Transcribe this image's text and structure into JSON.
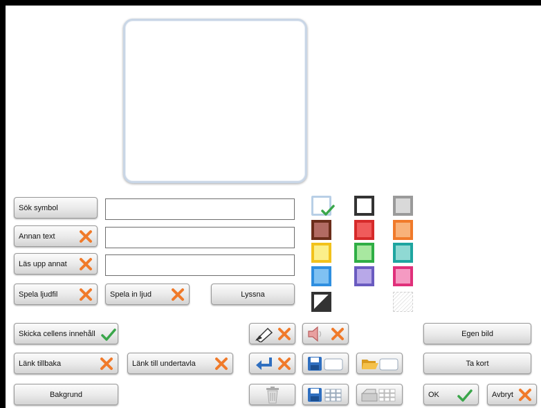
{
  "buttons": {
    "sok_symbol": "Sök symbol",
    "annan_text": "Annan text",
    "las_upp_annat": "Läs upp annat",
    "spela_ljudfil": "Spela ljudfil",
    "spela_in_ljud": "Spela in ljud",
    "lyssna": "Lyssna",
    "skicka_cellens_innehall": "Skicka cellens innehåll",
    "lank_tillbaka": "Länk tillbaka",
    "lank_till_undertavla": "Länk till undertavla",
    "bakgrund": "Bakgrund",
    "egen_bild": "Egen bild",
    "ta_kort": "Ta kort",
    "ok": "OK",
    "avbryt": "Avbryt"
  },
  "inputs": {
    "symbol_search": "",
    "other_text": "",
    "read_aloud_other": ""
  },
  "swatches": [
    {
      "name": "white",
      "border": "#333333",
      "fill": "#ffffff",
      "selected": false
    },
    {
      "name": "grey",
      "border": "#9a9a9a",
      "fill": "#d9d9d9",
      "selected": false
    },
    {
      "name": "brown",
      "border": "#6b2d1a",
      "fill": "#b26b63",
      "selected": false
    },
    {
      "name": "red",
      "border": "#d62a2a",
      "fill": "#f05b5b",
      "selected": false
    },
    {
      "name": "orange",
      "border": "#f07a2a",
      "fill": "#f8b27a",
      "selected": false
    },
    {
      "name": "yellow",
      "border": "#f2c21c",
      "fill": "#fbef8a",
      "selected": false
    },
    {
      "name": "green",
      "border": "#2fae45",
      "fill": "#a8e8a0",
      "selected": false
    },
    {
      "name": "teal",
      "border": "#1ea5a0",
      "fill": "#8fd9d3",
      "selected": false
    },
    {
      "name": "blue",
      "border": "#2f8fe0",
      "fill": "#7fc1f2",
      "selected": false
    },
    {
      "name": "purple",
      "border": "#6a5bc0",
      "fill": "#b8a8e8",
      "selected": false
    },
    {
      "name": "pink",
      "border": "#e0307a",
      "fill": "#f59ac2",
      "selected": false
    },
    {
      "name": "black-white-split",
      "border": "#333333",
      "fill": "#ffffff",
      "selected": false
    },
    {
      "name": "transparent",
      "border": "#d0d0d0",
      "fill": "#ffffff",
      "selected": false
    },
    {
      "name": "light-blue-selected",
      "border": "#b8cfe6",
      "fill": "#ffffff",
      "selected": true
    }
  ],
  "colors": {
    "x_icon": "#f07a2a",
    "check_icon": "#3aa64a",
    "preview_border": "#c9d6e6",
    "button_border": "#9a9a9a"
  },
  "icons": [
    "x-icon",
    "check-icon",
    "edit-symbol-icon",
    "speaker-icon",
    "enter-arrow-icon",
    "save-icon",
    "open-folder-icon",
    "trash-icon",
    "save-grid-icon",
    "print-grid-icon"
  ]
}
